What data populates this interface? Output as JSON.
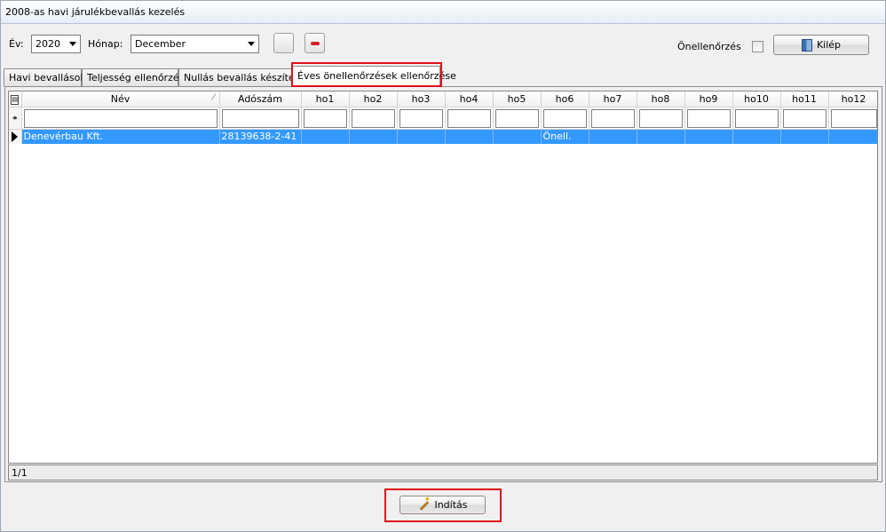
{
  "window": {
    "title": "2008-as havi járulékbevallás kezelés"
  },
  "toolbar": {
    "year_label": "Év:",
    "year_value": "2020",
    "month_label": "Hónap:",
    "month_value": "December",
    "self_check_label": "Önellenőrzés",
    "self_check_checked": false,
    "exit_label": "Kilép",
    "exit_icon": "door-exit-icon",
    "delete_icon": "minus-icon",
    "delete_color": "#d6202a"
  },
  "tabs": [
    {
      "label": "Havi bevallások",
      "active": false
    },
    {
      "label": "Teljesség ellenőrzés",
      "active": false
    },
    {
      "label": "Nullás bevallás készítése",
      "active": false
    },
    {
      "label": "Éves önellenőrzések ellenőrzése",
      "active": true
    }
  ],
  "grid": {
    "columns": [
      "Név",
      "Adószám",
      "ho1",
      "ho2",
      "ho3",
      "ho4",
      "ho5",
      "ho6",
      "ho7",
      "ho8",
      "ho9",
      "ho10",
      "ho11",
      "ho12"
    ],
    "rows": [
      {
        "cells": [
          "Denevérbau Kft.",
          "28139638-2-41",
          "",
          "",
          "",
          "",
          "",
          "Önell.",
          "",
          "",
          "",
          "",
          "",
          ""
        ],
        "selected": true
      }
    ],
    "selection_color": "#3399ff"
  },
  "status": {
    "record_counter": "1/1"
  },
  "footer": {
    "start_label": "Indítás",
    "start_icon": "wand-icon"
  },
  "highlight_color": "#e0101a"
}
